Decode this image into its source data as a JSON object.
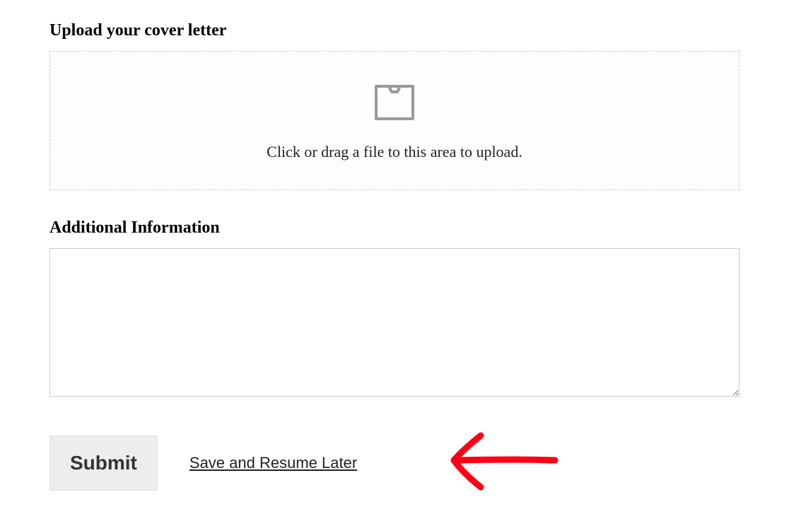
{
  "upload": {
    "label": "Upload your cover letter",
    "instructions": "Click or drag a file to this area to upload."
  },
  "additional_info": {
    "label": "Additional Information",
    "value": ""
  },
  "actions": {
    "submit_label": "Submit",
    "save_resume_label": "Save and Resume Later"
  }
}
